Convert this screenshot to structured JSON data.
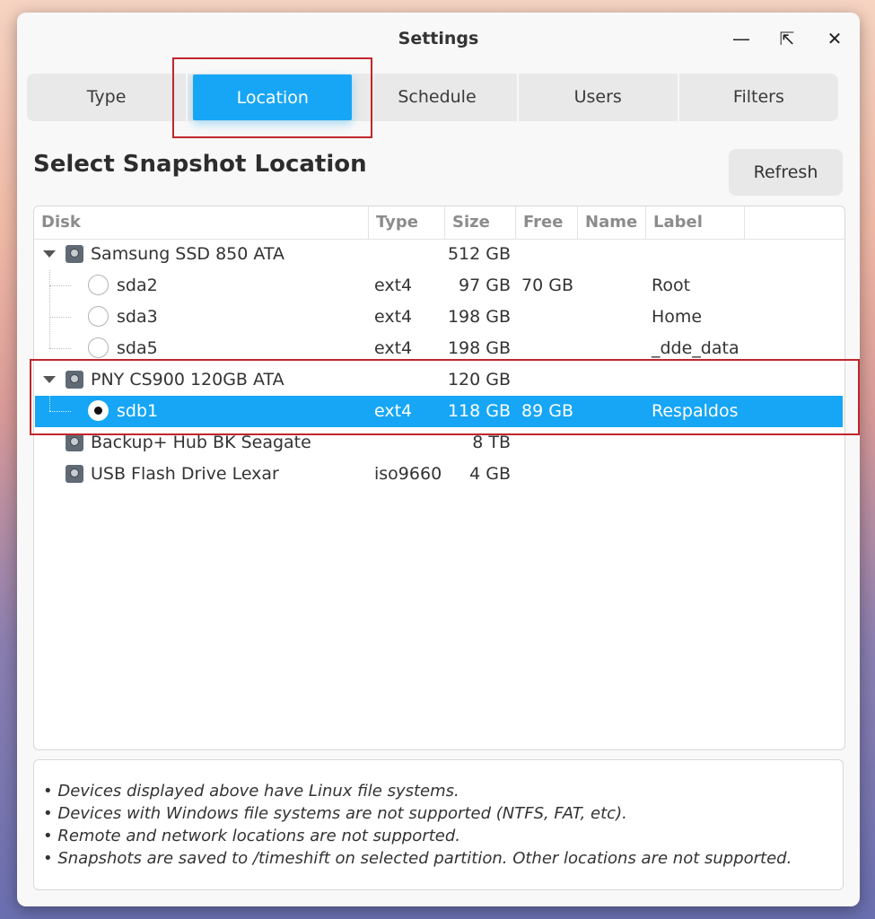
{
  "window": {
    "title": "Settings"
  },
  "tabs": [
    {
      "label": "Type",
      "active": false
    },
    {
      "label": "Location",
      "active": true
    },
    {
      "label": "Schedule",
      "active": false
    },
    {
      "label": "Users",
      "active": false
    },
    {
      "label": "Filters",
      "active": false
    }
  ],
  "heading": "Select Snapshot Location",
  "refresh_label": "Refresh",
  "columns": [
    "Disk",
    "Type",
    "Size",
    "Free",
    "Name",
    "Label"
  ],
  "rows": [
    {
      "kind": "disk",
      "name": "Samsung SSD 850 ATA",
      "type": "",
      "size": "512 GB",
      "free": "",
      "label": "",
      "expanded": true
    },
    {
      "kind": "part",
      "name": "sda2",
      "type": "ext4",
      "size": "97 GB",
      "free": "70 GB",
      "label": "Root",
      "selected": false
    },
    {
      "kind": "part",
      "name": "sda3",
      "type": "ext4",
      "size": "198 GB",
      "free": "",
      "label": "Home",
      "selected": false
    },
    {
      "kind": "part",
      "name": "sda5",
      "type": "ext4",
      "size": "198 GB",
      "free": "",
      "label": "_dde_data",
      "selected": false
    },
    {
      "kind": "disk",
      "name": "PNY CS900 120GB ATA",
      "type": "",
      "size": "120 GB",
      "free": "",
      "label": "",
      "expanded": true
    },
    {
      "kind": "part",
      "name": "sdb1",
      "type": "ext4",
      "size": "118 GB",
      "free": "89 GB",
      "label": "Respaldos",
      "selected": true
    },
    {
      "kind": "disk",
      "name": "Backup+ Hub BK Seagate",
      "type": "",
      "size": "8 TB",
      "free": "",
      "label": "",
      "expanded": false
    },
    {
      "kind": "disk",
      "name": "USB Flash Drive Lexar",
      "type": "iso9660",
      "size": "4 GB",
      "free": "",
      "label": "",
      "expanded": false
    }
  ],
  "notes": [
    "• Devices displayed above have Linux file systems.",
    "• Devices with Windows file systems are not supported (NTFS, FAT, etc).",
    "• Remote and network locations are not supported.",
    "• Snapshots are saved to /timeshift on selected partition. Other locations are not supported."
  ],
  "colors": {
    "accent": "#16a6f5",
    "highlight_box": "#c0262c"
  }
}
